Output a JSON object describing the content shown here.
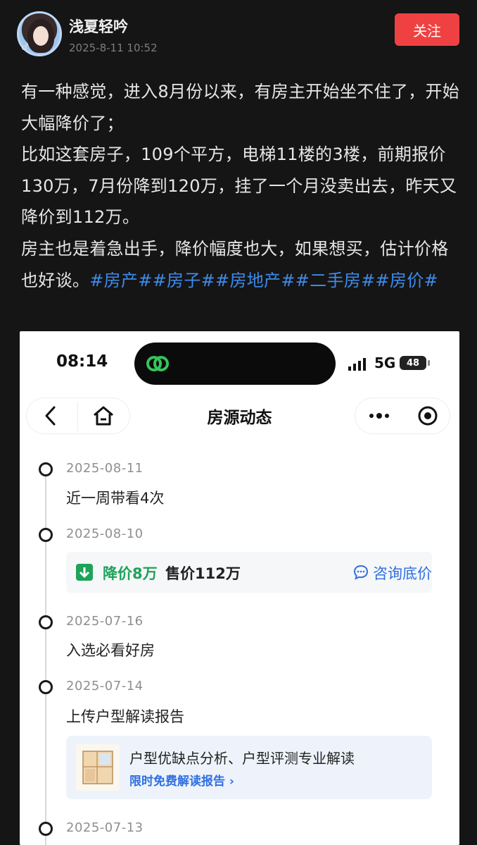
{
  "post": {
    "username": "浅夏轻吟",
    "time": "2025-8-11 10:52",
    "follow_label": "关注",
    "avatar_badge": "♂",
    "paragraphs": [
      "有一种感觉，进入8月份以来，有房主开始坐不住了，开始大幅降价了；",
      "比如这套房子，109个平方，电梯11楼的3楼，前期报价130万，7月份降到120万，挂了一个月没卖出去，昨天又降价到112万。",
      "房主也是着急出手，降价幅度也大，如果想买，估计价格也好谈。"
    ],
    "hashtags": [
      "#房产#",
      "#房子#",
      "#房地产#",
      "#二手房#",
      "#房价#"
    ]
  },
  "screenshot": {
    "status": {
      "time": "08:14",
      "network": "5G",
      "battery": "48"
    },
    "nav": {
      "title": "房源动态"
    },
    "timeline": [
      {
        "date": "2025-08-11",
        "text": "近一周带看4次"
      },
      {
        "date": "2025-08-10",
        "price_drop": "降价8万",
        "sale_price": "售价112万",
        "consult": "咨询底价"
      },
      {
        "date": "2025-07-16",
        "text": "入选必看好房"
      },
      {
        "date": "2025-07-14",
        "text": "上传户型解读报告",
        "report_title": "户型优缺点分析、户型评测专业解读",
        "report_link": "限时免费解读报告 ›"
      },
      {
        "date": "2025-07-13"
      }
    ]
  },
  "colors": {
    "background": "#151515",
    "follow": "#f04142",
    "hashtag": "#3d8bea",
    "price_drop_green": "#1fa25a",
    "link_blue": "#2f6fe0"
  }
}
